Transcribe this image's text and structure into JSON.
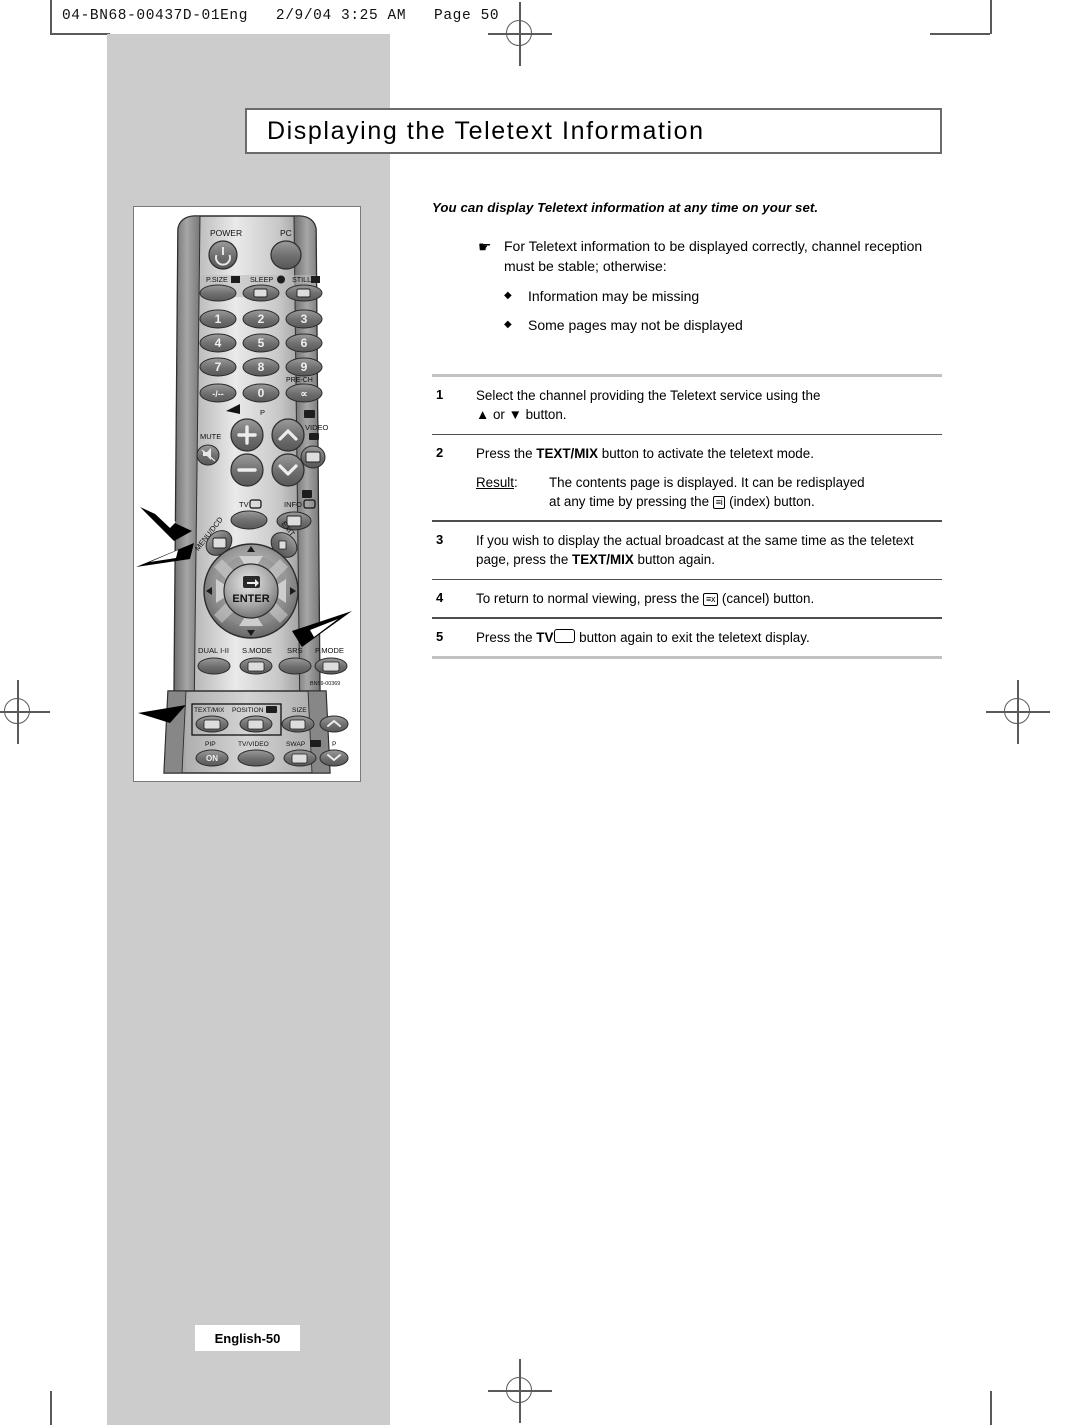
{
  "print_header": {
    "slug": "04-BN68-00437D-01Eng   2/9/04 3:25 AM   Page 50"
  },
  "title": {
    "heading": "Displaying the Teletext Information"
  },
  "intro": {
    "lead": "You can display Teletext information at any time on your set.",
    "hand_icon": "☛",
    "note": "For Teletext information to be displayed correctly, channel reception must be stable; otherwise:",
    "bullet_glyph": "◆",
    "bullets": [
      "Information may be missing",
      "Some pages may not be displayed"
    ]
  },
  "steps": [
    {
      "number": "1",
      "text_before": "Select the channel providing the Teletext service using the",
      "text_after": "▲ or ▼ button.",
      "bold": ""
    },
    {
      "number": "2",
      "text_before": "Press the ",
      "bold": "TEXT/MIX",
      "text_after": " button to activate the teletext mode.",
      "result_label": "Result",
      "result_colon": ":",
      "result_text_a": "The contents page is displayed. It can be redisplayed",
      "result_text_b_pre": "at any time by pressing the ",
      "result_icon": "≡i",
      "result_text_b_post": " (index) button."
    },
    {
      "number": "3",
      "text_before": "If you wish to display the actual broadcast at the same time as the teletext page, press the ",
      "bold": "TEXT/MIX",
      "text_after": " button again."
    },
    {
      "number": "4",
      "text_before": "To return to normal viewing, press the ",
      "icon": "≡x",
      "text_after": " (cancel) button."
    },
    {
      "number": "5",
      "text_before": "Press the ",
      "bold": "TV",
      "text_after": " button again to exit the teletext display."
    }
  ],
  "remote": {
    "caption_model": "BN59-00369",
    "buttons": {
      "power": "POWER",
      "pc": "PC",
      "p_size": "P.SIZE",
      "sleep": "SLEEP",
      "still": "STILL",
      "keys": [
        "1",
        "2",
        "3",
        "4",
        "5",
        "6",
        "7",
        "8",
        "9",
        "-/--",
        "0"
      ],
      "pre_ch": "PRE-CH",
      "mute": "MUTE",
      "p": "P",
      "video": "VIDEO",
      "tv": "TV",
      "info": "INFO",
      "menu": "MENU/DCD",
      "exit": "EXIT",
      "enter": "ENTER",
      "dual": "DUAL I-II",
      "s_mode": "S.MODE",
      "srs": "SRS",
      "p_mode": "P.MODE",
      "text_mix": "TEXT/MIX",
      "position": "POSITION",
      "size": "SIZE",
      "pip": "PIP",
      "pip_on": "ON",
      "tv_video": "TV/VIDEO",
      "swap": "SWAP",
      "p_bottom": "P"
    }
  },
  "footer": {
    "page_label": "English-50"
  },
  "colors": {
    "panel_gray": "#cccccc",
    "rule_light": "#c2c2c2",
    "rule_dark": "#4d4d4d",
    "title_border": "#6b6b6b"
  }
}
